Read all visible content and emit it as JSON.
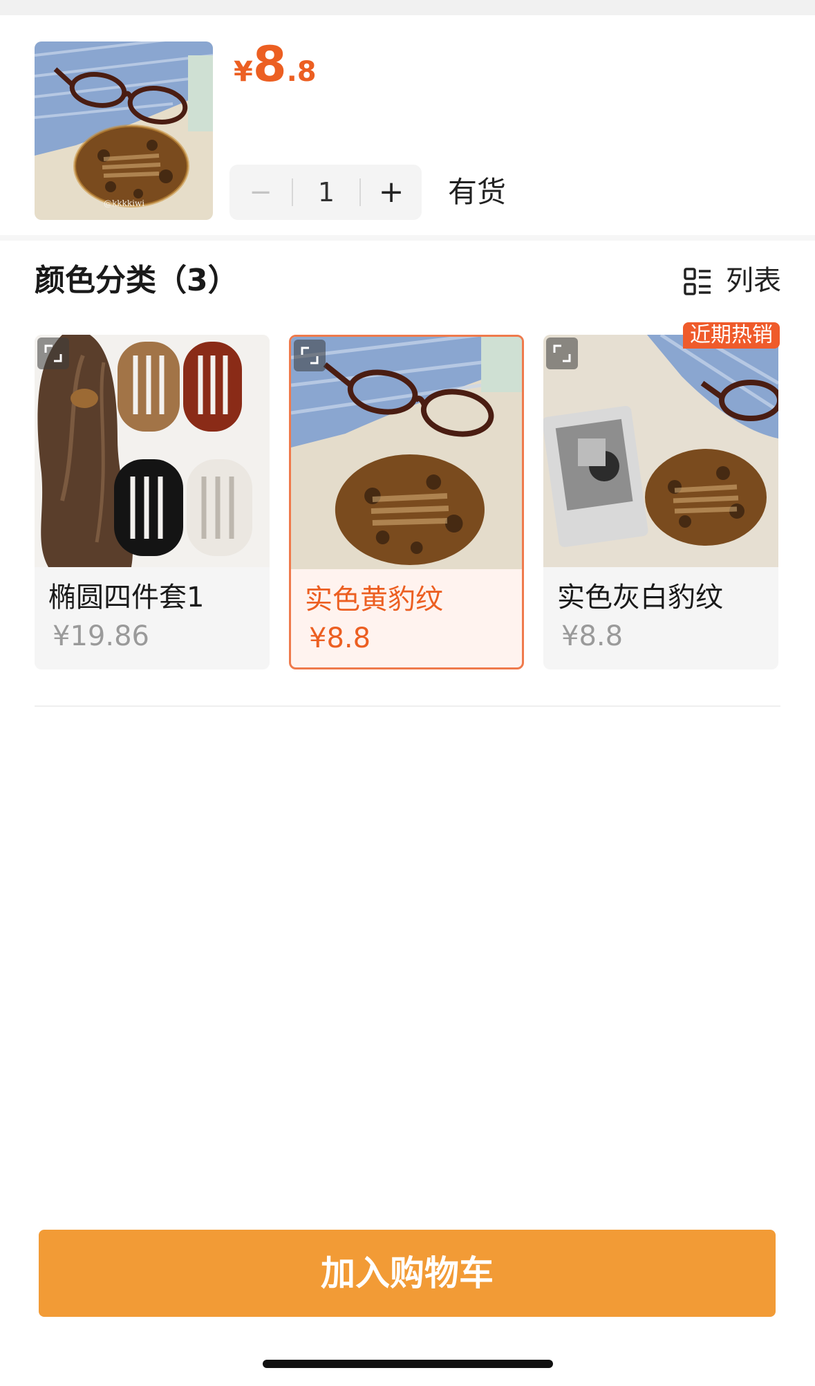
{
  "product": {
    "price_currency": "¥",
    "price_integer": "8",
    "price_decimal": ".8",
    "image_watermark": "@kkkkiwi"
  },
  "quantity": {
    "minus_label": "−",
    "value": "1",
    "plus_label": "+",
    "stock_status": "有货"
  },
  "options_section": {
    "title": "颜色分类（3）",
    "list_view_label": "列表",
    "hot_badge": "近期热销",
    "selected_index": 1,
    "items": [
      {
        "name": "椭圆四件套1",
        "price": "¥19.86"
      },
      {
        "name": "实色黄豹纹",
        "price": "¥8.8"
      },
      {
        "name": "实色灰白豹纹",
        "price": "¥8.8"
      }
    ]
  },
  "cart_button_label": "加入购物车",
  "colors": {
    "accent_orange": "#ec5f22",
    "button_orange": "#f29b36",
    "badge_red": "#ef5b2b"
  }
}
